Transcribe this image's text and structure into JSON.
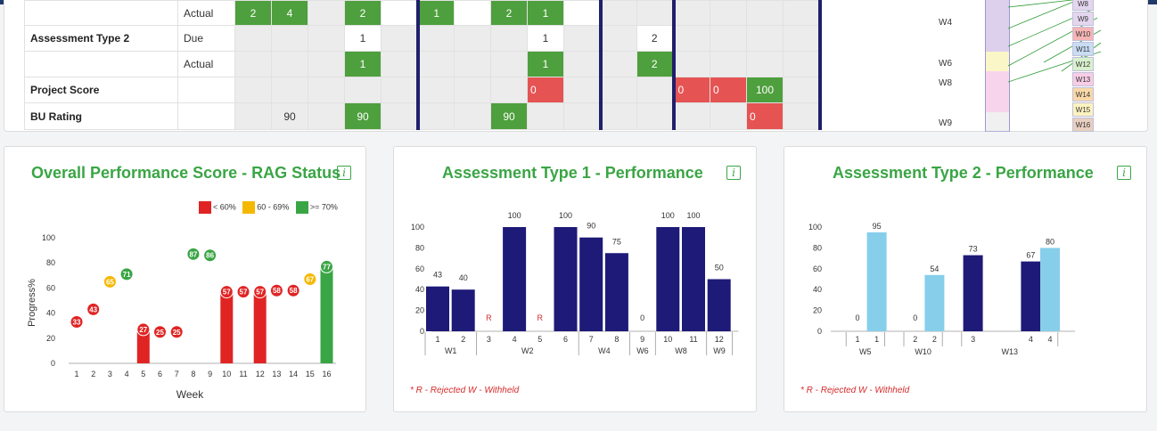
{
  "colors": {
    "green": "#3aa545",
    "red": "#e02424",
    "amber": "#f5b800",
    "dark_bar": "#1e1a78",
    "light_bar": "#87ceeb",
    "grid_green": "#4e9f3d",
    "grid_red": "#e55353"
  },
  "top_table": {
    "rows": [
      {
        "head": "",
        "sub": "Actual",
        "cells": [
          {
            "t": "2",
            "c": "green"
          },
          {
            "t": "4",
            "c": "green"
          },
          {
            "t": "",
            "c": "g"
          },
          {
            "t": "2",
            "c": "green"
          },
          {
            "t": "",
            "c": "cell",
            "sep": true
          },
          {
            "t": "1",
            "c": "green"
          },
          {
            "t": "",
            "c": "cell"
          },
          {
            "t": "2",
            "c": "green"
          },
          {
            "t": "1",
            "c": "green"
          },
          {
            "t": "",
            "c": "cell",
            "sep": true
          },
          {
            "t": "",
            "c": "g"
          },
          {
            "t": "",
            "c": "g",
            "sep": true
          },
          {
            "t": "",
            "c": "g"
          },
          {
            "t": "",
            "c": "g"
          },
          {
            "t": "",
            "c": "g"
          },
          {
            "t": "",
            "c": "g",
            "sep": true
          }
        ]
      },
      {
        "head": "Assessment Type 2",
        "sub": "Due",
        "cells": [
          {
            "t": "",
            "c": "g"
          },
          {
            "t": "",
            "c": "g"
          },
          {
            "t": "",
            "c": "g"
          },
          {
            "t": "1",
            "c": "cell"
          },
          {
            "t": "",
            "c": "g",
            "sep": true
          },
          {
            "t": "",
            "c": "g"
          },
          {
            "t": "",
            "c": "g"
          },
          {
            "t": "",
            "c": "g"
          },
          {
            "t": "1",
            "c": "cell"
          },
          {
            "t": "",
            "c": "g",
            "sep": true
          },
          {
            "t": "",
            "c": "g"
          },
          {
            "t": "2",
            "c": "cell",
            "sep": true
          },
          {
            "t": "",
            "c": "g"
          },
          {
            "t": "",
            "c": "g"
          },
          {
            "t": "",
            "c": "g"
          },
          {
            "t": "",
            "c": "g",
            "sep": true
          }
        ]
      },
      {
        "head": "",
        "sub": "Actual",
        "cells": [
          {
            "t": "",
            "c": "g"
          },
          {
            "t": "",
            "c": "g"
          },
          {
            "t": "",
            "c": "g"
          },
          {
            "t": "1",
            "c": "green"
          },
          {
            "t": "",
            "c": "g",
            "sep": true
          },
          {
            "t": "",
            "c": "g"
          },
          {
            "t": "",
            "c": "g"
          },
          {
            "t": "",
            "c": "g"
          },
          {
            "t": "1",
            "c": "green"
          },
          {
            "t": "",
            "c": "g",
            "sep": true
          },
          {
            "t": "",
            "c": "g"
          },
          {
            "t": "2",
            "c": "green",
            "sep": true
          },
          {
            "t": "",
            "c": "g"
          },
          {
            "t": "",
            "c": "g"
          },
          {
            "t": "",
            "c": "g"
          },
          {
            "t": "",
            "c": "g",
            "sep": true
          }
        ]
      },
      {
        "head": "Project Score",
        "sub": "",
        "cells": [
          {
            "t": "",
            "c": "g"
          },
          {
            "t": "",
            "c": "g"
          },
          {
            "t": "",
            "c": "g"
          },
          {
            "t": "",
            "c": "g"
          },
          {
            "t": "",
            "c": "g",
            "sep": true
          },
          {
            "t": "",
            "c": "g"
          },
          {
            "t": "",
            "c": "g"
          },
          {
            "t": "",
            "c": "g"
          },
          {
            "t": "0",
            "c": "red"
          },
          {
            "t": "",
            "c": "g",
            "sep": true
          },
          {
            "t": "",
            "c": "g"
          },
          {
            "t": "",
            "c": "g",
            "sep": true
          },
          {
            "t": "0",
            "c": "red"
          },
          {
            "t": "0",
            "c": "red"
          },
          {
            "t": "100",
            "c": "green"
          },
          {
            "t": "",
            "c": "g",
            "sep": true
          }
        ]
      },
      {
        "head": "BU Rating",
        "sub": "",
        "cells": [
          {
            "t": "",
            "c": "g"
          },
          {
            "t": "90",
            "c": "g"
          },
          {
            "t": "",
            "c": "g"
          },
          {
            "t": "90",
            "c": "green"
          },
          {
            "t": "",
            "c": "g",
            "sep": true
          },
          {
            "t": "",
            "c": "g"
          },
          {
            "t": "",
            "c": "g"
          },
          {
            "t": "90",
            "c": "green"
          },
          {
            "t": "",
            "c": "g"
          },
          {
            "t": "",
            "c": "g",
            "sep": true
          },
          {
            "t": "",
            "c": "g"
          },
          {
            "t": "",
            "c": "g",
            "sep": true
          },
          {
            "t": "",
            "c": "g"
          },
          {
            "t": "",
            "c": "g"
          },
          {
            "t": "0",
            "c": "red"
          },
          {
            "t": "",
            "c": "g",
            "sep": true
          }
        ]
      }
    ]
  },
  "week_labels": [
    "W4",
    "W6",
    "W8",
    "W9"
  ],
  "week_boxes": [
    {
      "label": "W8",
      "color": "#e4d6ee"
    },
    {
      "label": "W9",
      "color": "#e4d6ee"
    },
    {
      "label": "W10",
      "color": "#f6b4b4"
    },
    {
      "label": "W11",
      "color": "#c9dcf4"
    },
    {
      "label": "W12",
      "color": "#d8f0cc"
    },
    {
      "label": "W13",
      "color": "#f8cde6"
    },
    {
      "label": "W14",
      "color": "#f9d8a8"
    },
    {
      "label": "W15",
      "color": "#fdf3c0"
    },
    {
      "label": "W16",
      "color": "#e8cfc0"
    }
  ],
  "stack_colors": [
    "#dcd0ec",
    "#dcd0ec",
    "#fbf6c8",
    "#f8d4ec",
    "#f8d4ec",
    "#f0f0f0"
  ],
  "card1": {
    "title": "Overall Performance Score - RAG Status",
    "info": "i",
    "legend": [
      "< 60%",
      "60 - 69%",
      ">= 70%"
    ]
  },
  "card2": {
    "title": "Assessment Type 1 - Performance",
    "info": "i",
    "footnote": "*   R - Rejected    W - Withheld"
  },
  "card3": {
    "title": "Assessment Type 2 - Performance",
    "info": "i",
    "footnote": "*   R - Rejected    W - Withheld"
  },
  "chart_data": [
    {
      "type": "bar",
      "title": "Overall Performance Score - RAG Status",
      "xlabel": "Week",
      "ylabel": "Progress%",
      "ylim": [
        0,
        100
      ],
      "yticks": [
        0,
        20,
        40,
        60,
        80,
        100
      ],
      "categories": [
        "1",
        "2",
        "3",
        "4",
        "5",
        "6",
        "7",
        "8",
        "9",
        "10",
        "11",
        "12",
        "13",
        "14",
        "15",
        "16"
      ],
      "points": [
        {
          "x": "1",
          "value": 33,
          "rag": "red",
          "bar": false
        },
        {
          "x": "2",
          "value": 43,
          "rag": "red",
          "bar": false
        },
        {
          "x": "3",
          "value": 65,
          "rag": "amber",
          "bar": false
        },
        {
          "x": "4",
          "value": 71,
          "rag": "green",
          "bar": false
        },
        {
          "x": "5",
          "value": 27,
          "rag": "red",
          "bar": true
        },
        {
          "x": "6",
          "value": 25,
          "rag": "red",
          "bar": false
        },
        {
          "x": "7",
          "value": 25,
          "rag": "red",
          "bar": false
        },
        {
          "x": "8",
          "value": 87,
          "rag": "green",
          "bar": false
        },
        {
          "x": "9",
          "value": 86,
          "rag": "green",
          "bar": false
        },
        {
          "x": "10",
          "value": 57,
          "rag": "red",
          "bar": true
        },
        {
          "x": "11",
          "value": 57,
          "rag": "red",
          "bar": false
        },
        {
          "x": "12",
          "value": 57,
          "rag": "red",
          "bar": true
        },
        {
          "x": "13",
          "value": 58,
          "rag": "red",
          "bar": false
        },
        {
          "x": "14",
          "value": 58,
          "rag": "red",
          "bar": false
        },
        {
          "x": "15",
          "value": 67,
          "rag": "amber",
          "bar": false
        },
        {
          "x": "16",
          "value": 77,
          "rag": "green",
          "bar": true
        }
      ],
      "legend": [
        "< 60%",
        "60 - 69%",
        ">= 70%"
      ]
    },
    {
      "type": "bar",
      "title": "Assessment Type 1 - Performance",
      "ylim": [
        0,
        100
      ],
      "yticks": [
        0,
        20,
        40,
        60,
        80,
        100
      ],
      "bars": [
        {
          "x": "1",
          "value": 43,
          "label": "43"
        },
        {
          "x": "2",
          "value": 40,
          "label": "40"
        },
        {
          "x": "3",
          "value": 0,
          "label": "R",
          "flag": true
        },
        {
          "x": "4",
          "value": 100,
          "label": "100"
        },
        {
          "x": "5",
          "value": 0,
          "label": "R",
          "flag": true
        },
        {
          "x": "6",
          "value": 100,
          "label": "100"
        },
        {
          "x": "7",
          "value": 90,
          "label": "90"
        },
        {
          "x": "8",
          "value": 75,
          "label": "75"
        },
        {
          "x": "9",
          "value": 0,
          "label": "0"
        },
        {
          "x": "10",
          "value": 100,
          "label": "100"
        },
        {
          "x": "11",
          "value": 100,
          "label": "100"
        },
        {
          "x": "12",
          "value": 50,
          "label": "50"
        }
      ],
      "groups": [
        {
          "label": "W1",
          "span": 2
        },
        {
          "label": "W2",
          "span": 4
        },
        {
          "label": "W4",
          "span": 2
        },
        {
          "label": "W6",
          "span": 1
        },
        {
          "label": "W8",
          "span": 2
        },
        {
          "label": "W9",
          "span": 1
        }
      ]
    },
    {
      "type": "bar",
      "title": "Assessment Type 2 - Performance",
      "ylim": [
        0,
        100
      ],
      "yticks": [
        0,
        20,
        40,
        60,
        80,
        100
      ],
      "bars": [
        {
          "x": "1",
          "value": 0,
          "label": "0",
          "kind": "dark",
          "slot": 0
        },
        {
          "x": "1",
          "value": 95,
          "label": "95",
          "kind": "light",
          "slot": 1
        },
        {
          "x": "2",
          "value": 0,
          "label": "0",
          "kind": "dark",
          "slot": 3
        },
        {
          "x": "2",
          "value": 54,
          "label": "54",
          "kind": "light",
          "slot": 4
        },
        {
          "x": "3",
          "value": 73,
          "label": "73",
          "kind": "dark",
          "slot": 6
        },
        {
          "x": "4",
          "value": 67,
          "label": "67",
          "kind": "dark",
          "slot": 9
        },
        {
          "x": "4",
          "value": 80,
          "label": "80",
          "kind": "light",
          "slot": 10
        }
      ],
      "groups": [
        {
          "label": "W5",
          "from": 0,
          "to": 2
        },
        {
          "label": "W10",
          "from": 3,
          "to": 5
        },
        {
          "label": "W13",
          "from": 6,
          "to": 11
        }
      ]
    }
  ]
}
